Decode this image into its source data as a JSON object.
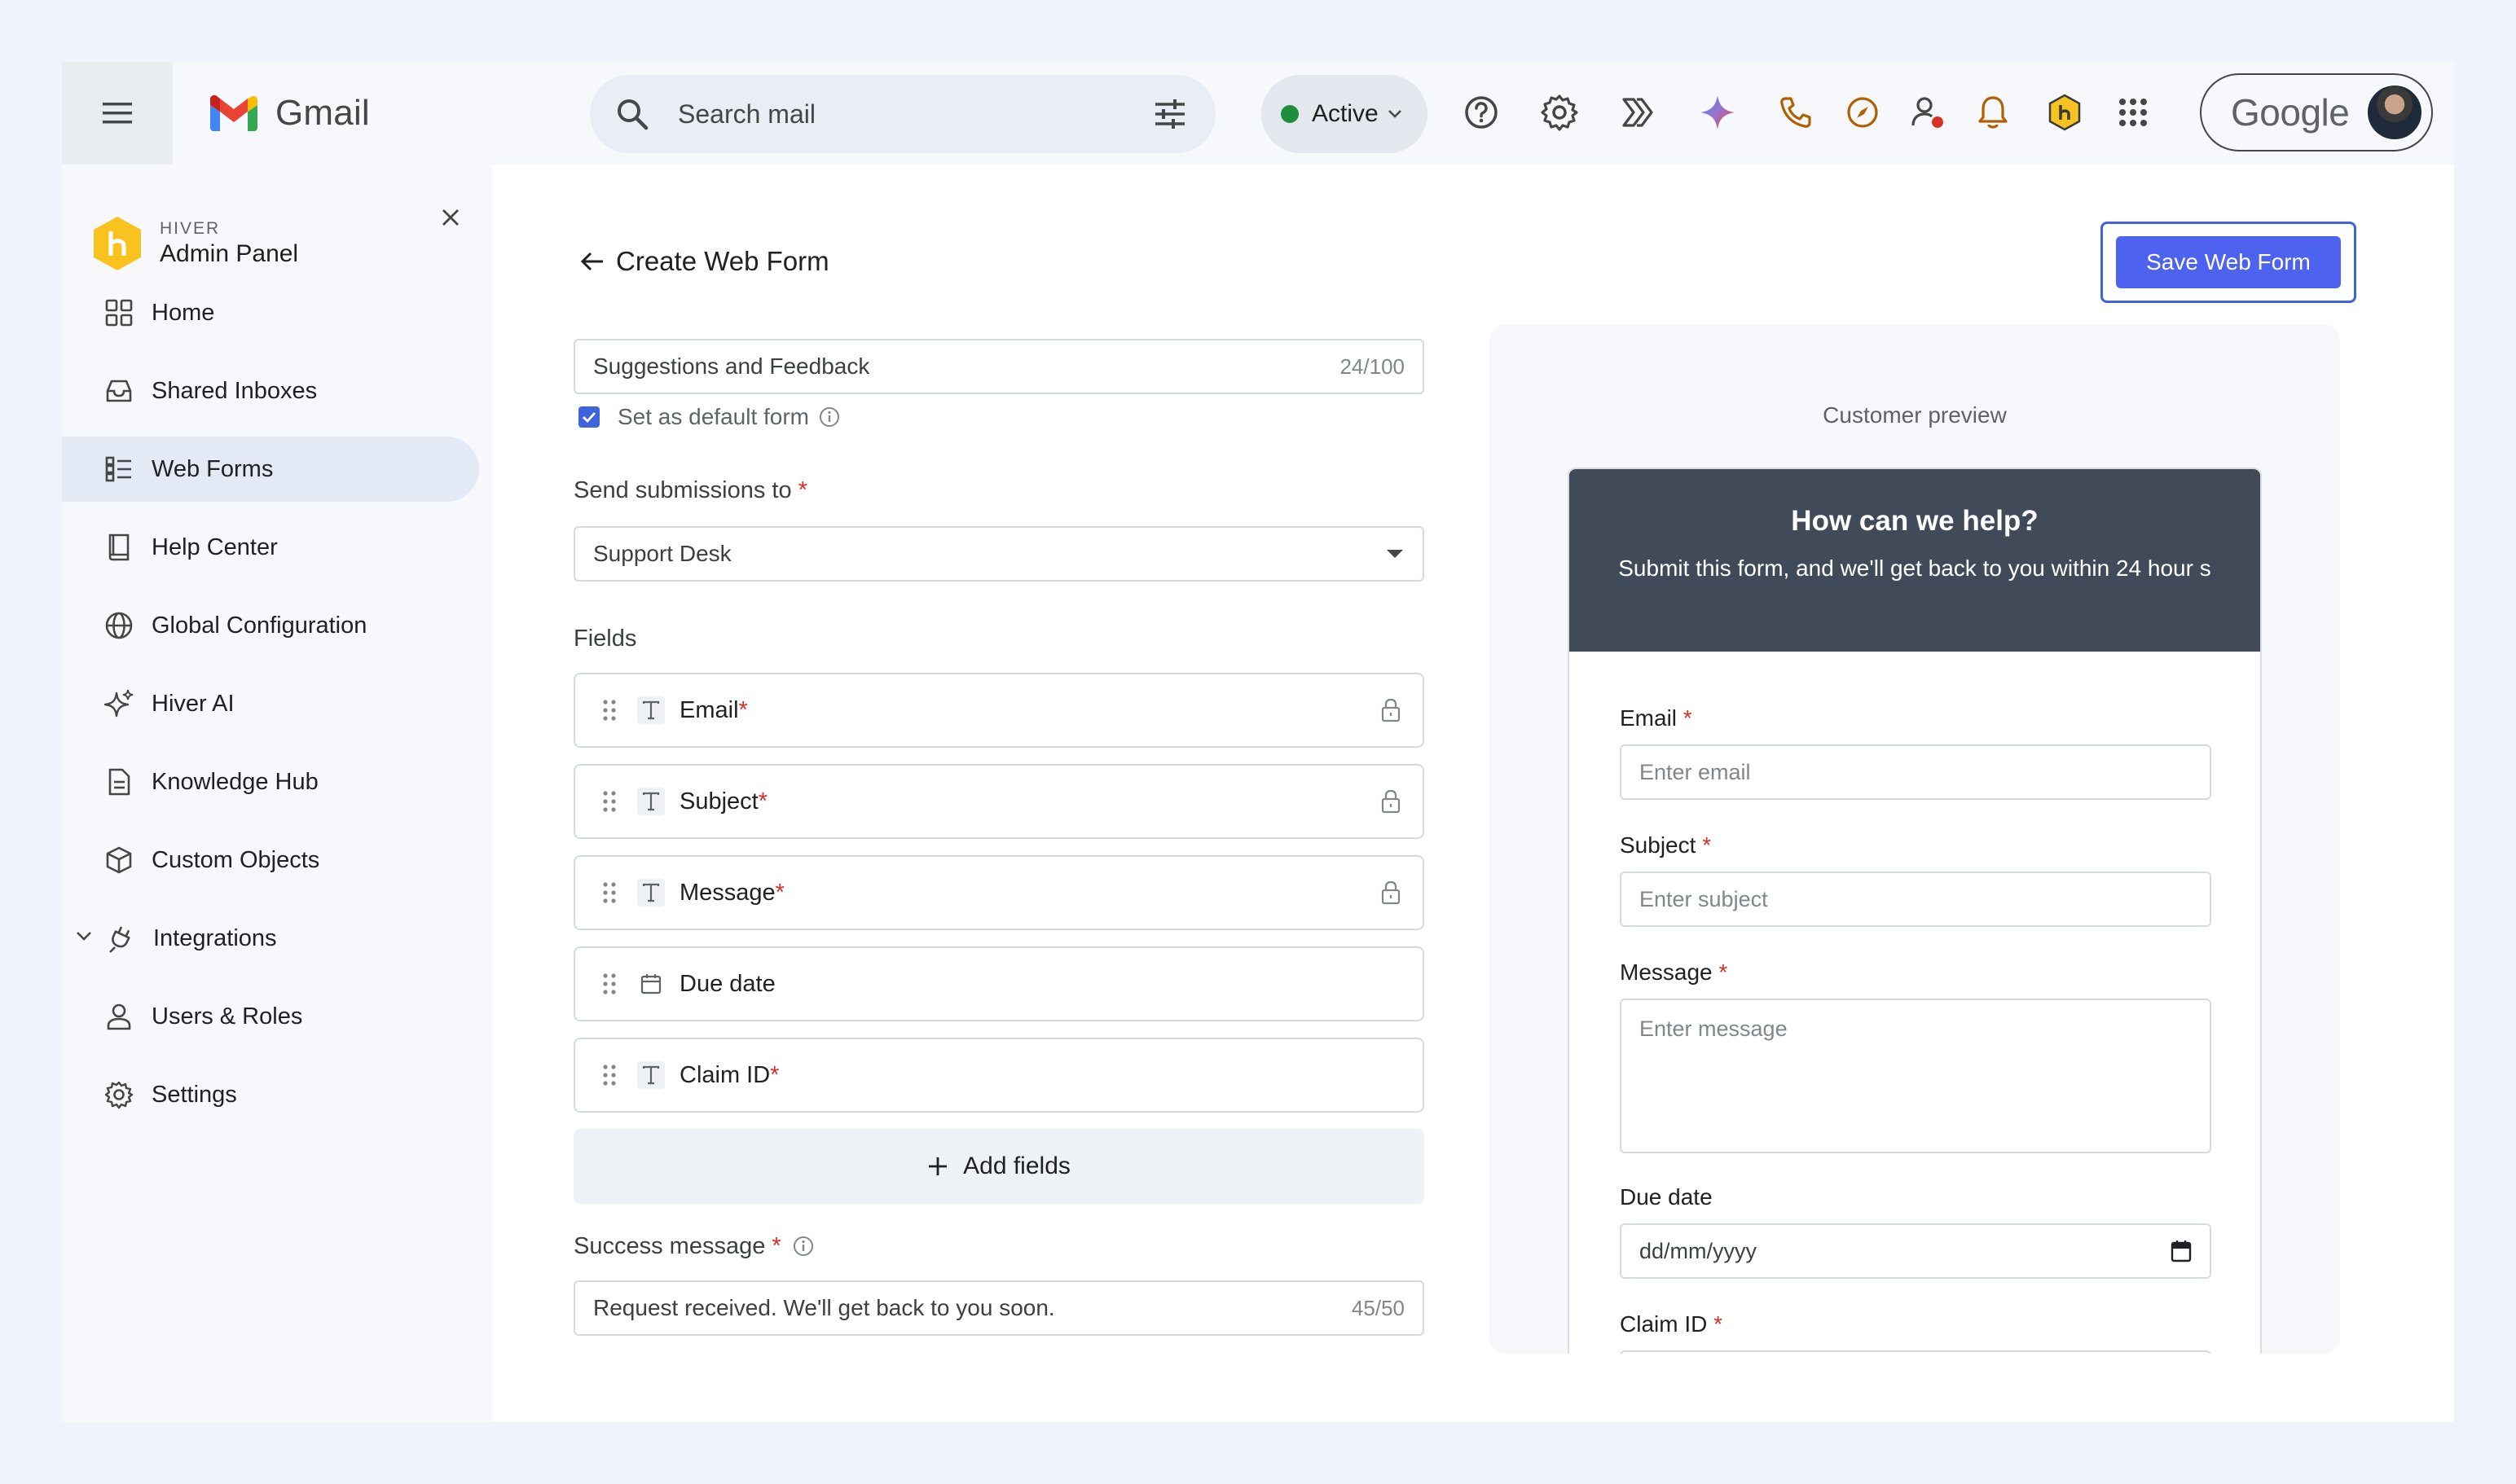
{
  "topbar": {
    "app_name": "Gmail",
    "search_text": "Search mail",
    "status": "Active",
    "google_label": "Google"
  },
  "sidebar": {
    "brand_eyebrow": "HIVER",
    "brand_title": "Admin Panel",
    "items": [
      {
        "label": "Home",
        "icon": "grid-icon"
      },
      {
        "label": "Shared Inboxes",
        "icon": "inbox-icon"
      },
      {
        "label": "Web Forms",
        "icon": "list-icon",
        "active": true
      },
      {
        "label": "Help Center",
        "icon": "book-icon"
      },
      {
        "label": "Global Configuration",
        "icon": "globe-icon"
      },
      {
        "label": "Hiver AI",
        "icon": "sparkle-icon"
      },
      {
        "label": "Knowledge Hub",
        "icon": "document-icon"
      },
      {
        "label": "Custom Objects",
        "icon": "cube-icon"
      },
      {
        "label": "Integrations",
        "icon": "plug-icon"
      },
      {
        "label": "Users & Roles",
        "icon": "user-icon"
      },
      {
        "label": "Settings",
        "icon": "gear-icon"
      }
    ]
  },
  "main": {
    "page_title": "Create Web Form",
    "save_label": "Save Web Form",
    "form_name": {
      "value": "Suggestions and Feedback",
      "count": "24/100"
    },
    "default_form_label": "Set as default form",
    "send_to": {
      "label": "Send submissions to",
      "required": "*",
      "value": "Support Desk"
    },
    "fields_label": "Fields",
    "fields": [
      {
        "name": "Email",
        "required": "*",
        "locked": true,
        "type": "text-icon"
      },
      {
        "name": "Subject",
        "required": "*",
        "locked": true,
        "type": "text-icon"
      },
      {
        "name": "Message",
        "required": "*",
        "locked": true,
        "type": "text-icon"
      },
      {
        "name": "Due date",
        "required": "",
        "locked": false,
        "type": "calendar-icon"
      },
      {
        "name": "Claim ID",
        "required": "*",
        "locked": false,
        "type": "text-icon"
      }
    ],
    "add_fields_label": "Add fields",
    "success": {
      "label": "Success message",
      "required": "*",
      "value": "Request received. We'll get back to you soon.",
      "count": "45/50"
    }
  },
  "preview": {
    "title": "Customer preview",
    "heading": "How can we help?",
    "subheading": "Submit this form, and we'll get back to you within 24 hour s",
    "fields": [
      {
        "label": "Email",
        "required": "*",
        "placeholder": "Enter email"
      },
      {
        "label": "Subject",
        "required": "*",
        "placeholder": "Enter subject"
      },
      {
        "label": "Message",
        "required": "*",
        "placeholder": "Enter message"
      },
      {
        "label": "Due date",
        "required": "",
        "placeholder": "dd/mm/yyyy"
      },
      {
        "label": "Claim ID",
        "required": "*",
        "placeholder": ""
      }
    ]
  },
  "colors": {
    "accent": "#4d62ef",
    "preview_header": "#414a58",
    "active_nav": "#e4e9f6",
    "status_green": "#1e8e3e",
    "required_red": "#d93025"
  }
}
